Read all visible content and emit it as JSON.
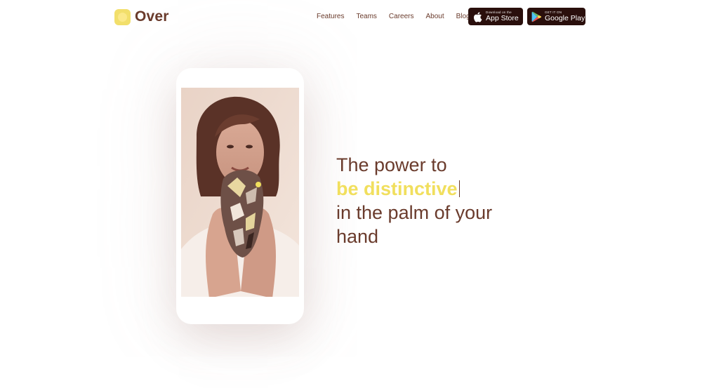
{
  "brand": {
    "name": "Over",
    "logo_icon": "over-logo-icon"
  },
  "nav": {
    "items": [
      {
        "label": "Features"
      },
      {
        "label": "Teams"
      },
      {
        "label": "Careers"
      },
      {
        "label": "About"
      },
      {
        "label": "Blog"
      }
    ]
  },
  "stores": {
    "apple": {
      "small": "Download on the",
      "big": "App Store",
      "icon": "apple-icon"
    },
    "google": {
      "small": "GET IT ON",
      "big": "Google Play",
      "icon": "google-play-icon"
    }
  },
  "hero": {
    "line1": "The power to",
    "accent": "be distinctive",
    "line3": "in the palm of your",
    "line4": "hand"
  },
  "colors": {
    "brand_brown": "#6a3b2c",
    "accent_yellow": "#f1df5d",
    "store_button_bg": "#2a0f0c"
  }
}
